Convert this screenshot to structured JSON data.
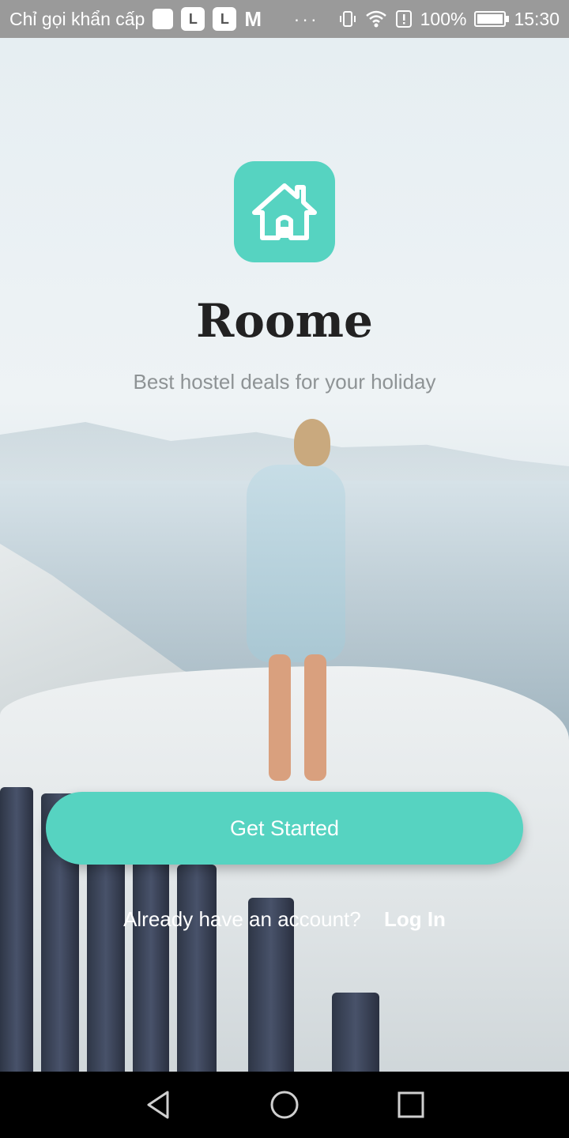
{
  "status_bar": {
    "carrier_text": "Chỉ gọi khẩn cấp",
    "app_letter_1": "L",
    "app_letter_2": "L",
    "app_letter_3": "M",
    "overflow": "···",
    "battery_percent": "100%",
    "time": "15:30",
    "icons": [
      "vibrate-icon",
      "wifi-icon",
      "alert-icon",
      "battery-icon"
    ]
  },
  "app": {
    "icon": "house-icon",
    "title": "Roome",
    "tagline": "Best hostel deals for your holiday",
    "brand_color": "#56d3c1"
  },
  "actions": {
    "get_started_label": "Get Started",
    "login_prompt": "Already have an account?",
    "login_label": "Log In"
  },
  "nav_bar": {
    "buttons": [
      "back-icon",
      "home-icon",
      "recents-icon"
    ]
  }
}
